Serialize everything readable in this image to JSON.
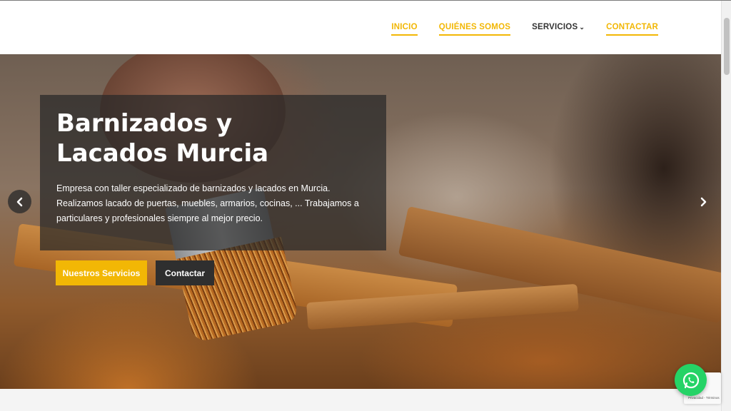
{
  "nav": {
    "items": [
      {
        "label": "INICIO",
        "active": true
      },
      {
        "label": "QUIÉNES SOMOS",
        "active": true
      },
      {
        "label": "SERVICIOS",
        "active": false,
        "dropdown": true
      },
      {
        "label": "CONTACTAR",
        "active": true
      }
    ]
  },
  "hero": {
    "title_line1": "Barnizados y",
    "title_line2": "Lacados Murcia",
    "text": "Empresa con taller especializado de barnizados y lacados en Murcia. Realizamos lacado de puertas, muebles, armarios, cocinas, ... Trabajamos a particulares y profesionales siempre al mejor precio.",
    "primary_button": "Nuestros Servicios",
    "secondary_button": "Contactar"
  },
  "recaptcha": {
    "text": "Privacidad - Términos"
  },
  "icons": {
    "prev": "chevron-left-icon",
    "next": "chevron-right-icon",
    "whatsapp": "whatsapp-icon",
    "dropdown": "chevron-down-icon"
  },
  "colors": {
    "accent": "#f2b705",
    "dark_button": "#2f2f2f",
    "whatsapp": "#25d366"
  }
}
